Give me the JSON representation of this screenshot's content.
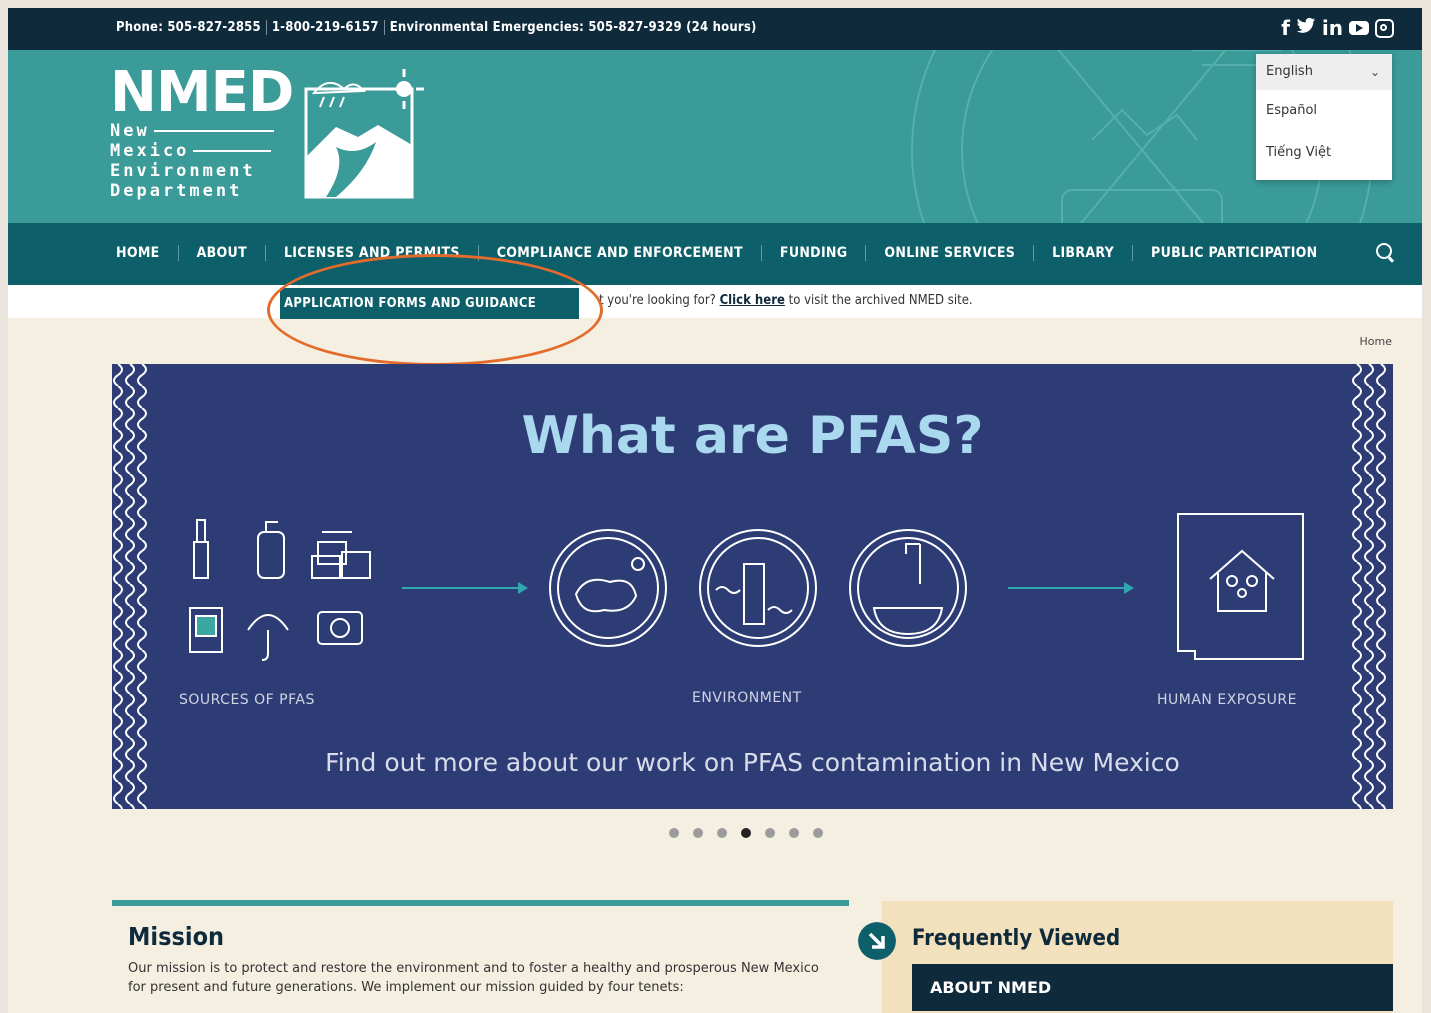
{
  "topbar": {
    "phone_label": "Phone: 505-827-2855",
    "toll_free": "1-800-219-6157",
    "emergency": "Environmental Emergencies: 505-827-9329 (24 hours)"
  },
  "social_icons": [
    "facebook-icon",
    "twitter-icon",
    "linkedin-icon",
    "youtube-icon",
    "instagram-icon"
  ],
  "logo": {
    "acronym": "NMED",
    "line1": "New",
    "line2": "Mexico",
    "line3": "Environment",
    "line4": "Department"
  },
  "language": {
    "selected": "English",
    "options": [
      "Español",
      "Tiếng Việt"
    ]
  },
  "nav": {
    "items": [
      "HOME",
      "ABOUT",
      "LICENSES AND PERMITS",
      "COMPLIANCE AND ENFORCEMENT",
      "FUNDING",
      "ONLINE SERVICES",
      "LIBRARY",
      "PUBLIC PARTICIPATION"
    ]
  },
  "dropdown": {
    "item": "APPLICATION FORMS AND GUIDANCE"
  },
  "notice": {
    "prefix": "t you're looking for?",
    "link": "Click here",
    "suffix": "to visit the archived NMED site."
  },
  "breadcrumb": "Home",
  "banner": {
    "title": "What are PFAS?",
    "label_sources": "SOURCES OF PFAS",
    "label_environment": "ENVIRONMENT",
    "label_exposure": "HUMAN EXPOSURE",
    "cta": "Find out more about our work on PFAS contamination in New Mexico"
  },
  "carousel": {
    "count": 7,
    "active_index": 3
  },
  "mission": {
    "title": "Mission",
    "text": "Our mission is to protect and restore the environment and to foster a healthy and prosperous New Mexico for present and future generations. We implement our mission guided by four tenets:"
  },
  "frequently_viewed": {
    "title": "Frequently Viewed",
    "first_item": "ABOUT NMED"
  },
  "colors": {
    "navy": "#0e2a3b",
    "teal": "#3a9b98",
    "dark_teal": "#0d5f69",
    "banner_blue": "#2d3c75",
    "highlight_orange": "#e36b2c"
  }
}
